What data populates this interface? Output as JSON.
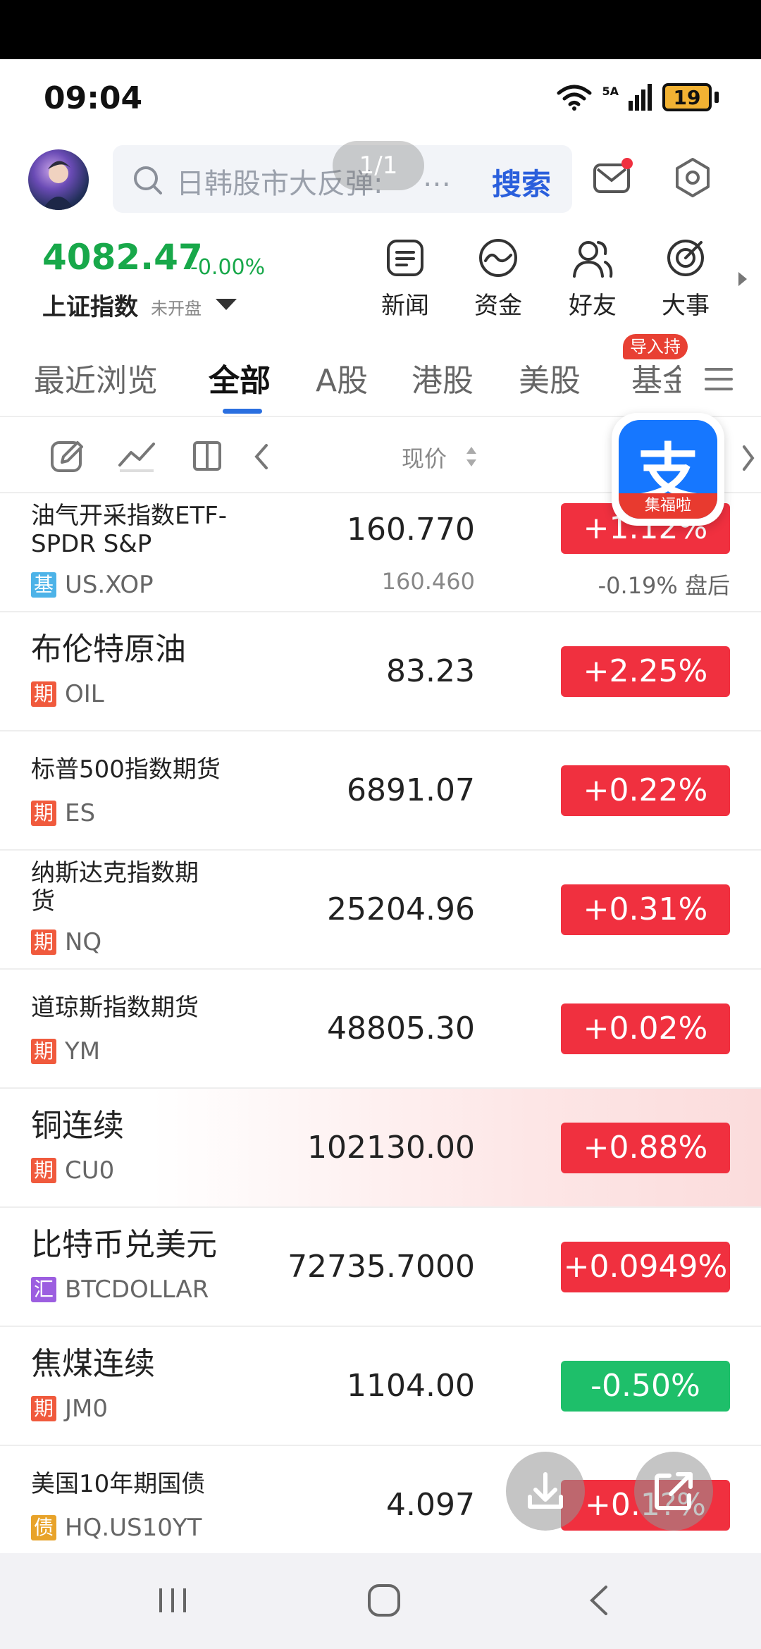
{
  "status": {
    "time": "09:04",
    "network": "5A",
    "battery": "19"
  },
  "search": {
    "placeholder": "日韩股市大反弹:",
    "ellipsis": "…",
    "page_indicator": "1/1",
    "button": "搜索"
  },
  "index": {
    "value": "4082.47",
    "change": "-0.00%",
    "name": "上证指数",
    "status": "未开盘"
  },
  "quick_links": [
    {
      "label": "新闻",
      "icon": "news-icon"
    },
    {
      "label": "资金",
      "icon": "funds-icon"
    },
    {
      "label": "好友",
      "icon": "friends-icon"
    },
    {
      "label": "大事",
      "icon": "events-icon"
    }
  ],
  "tabs": [
    {
      "label": "最近浏览",
      "active": false
    },
    {
      "label": "全部",
      "active": true
    },
    {
      "label": "A股",
      "active": false
    },
    {
      "label": "港股",
      "active": false
    },
    {
      "label": "美股",
      "active": false
    },
    {
      "label": "基金",
      "active": false
    }
  ],
  "import_badge": "导入持",
  "toolbar": {
    "sort_label": "现价"
  },
  "alipay": {
    "char": "支",
    "band": "集福啦"
  },
  "rows": [
    {
      "name": "油气开采指数ETF-SPDR S&P",
      "tag": "基",
      "code": "US.XOP",
      "price": "160.770",
      "subprice": "160.460",
      "change": "+1.12%",
      "dir": "up",
      "after_hours": "-0.19%  盘后"
    },
    {
      "name": "布伦特原油",
      "tag": "期",
      "code": "OIL",
      "price": "83.23",
      "change": "+2.25%",
      "dir": "up"
    },
    {
      "name": "标普500指数期货",
      "tag": "期",
      "code": "ES",
      "price": "6891.07",
      "change": "+0.22%",
      "dir": "up"
    },
    {
      "name": "纳斯达克指数期货",
      "tag": "期",
      "code": "NQ",
      "price": "25204.96",
      "change": "+0.31%",
      "dir": "up"
    },
    {
      "name": "道琼斯指数期货",
      "tag": "期",
      "code": "YM",
      "price": "48805.30",
      "change": "+0.02%",
      "dir": "up"
    },
    {
      "name": "铜连续",
      "tag": "期",
      "code": "CU0",
      "price": "102130.00",
      "change": "+0.88%",
      "dir": "up"
    },
    {
      "name": "比特币兑美元",
      "tag": "汇",
      "code": "BTCDOLLAR",
      "price": "72735.7000",
      "change": "+0.0949%",
      "dir": "up"
    },
    {
      "name": "焦煤连续",
      "tag": "期",
      "code": "JM0",
      "price": "1104.00",
      "change": "-0.50%",
      "dir": "down"
    },
    {
      "name": "美国10年期国债",
      "tag": "债",
      "code": "HQ.US10YT",
      "price": "4.097",
      "change": "+0.1?%",
      "dir": "up"
    }
  ],
  "colors": {
    "up": "#f0303f",
    "down": "#1ebf6a",
    "accent": "#2a6fe0",
    "index_green": "#18a84a"
  }
}
